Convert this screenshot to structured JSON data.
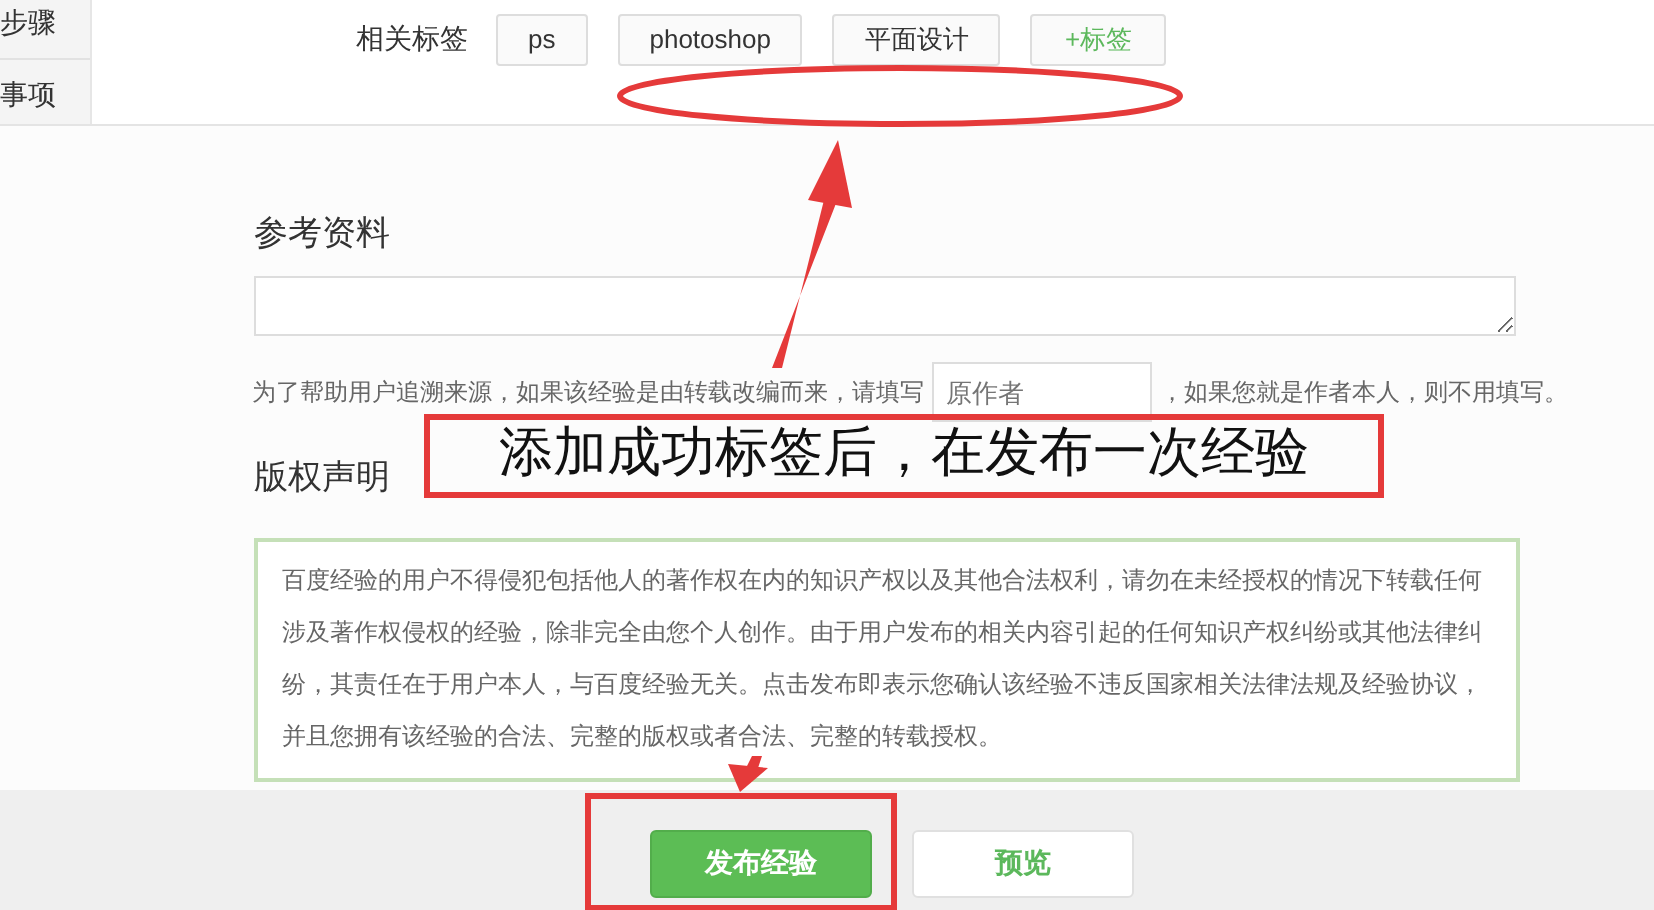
{
  "sidebar": {
    "items": [
      {
        "label": "步骤"
      },
      {
        "label": "事项"
      }
    ]
  },
  "tags": {
    "label": "相关标签",
    "items": [
      {
        "text": "ps",
        "kind": "tag"
      },
      {
        "text": "photoshop",
        "kind": "tag"
      },
      {
        "text": "平面设计",
        "kind": "tag"
      },
      {
        "text": "+标签",
        "kind": "add"
      }
    ]
  },
  "reference": {
    "heading": "参考资料",
    "hint_before": "为了帮助用户追溯来源，如果该经验是由转载改编而来，请填写",
    "author_field": {
      "placeholder": "原作者"
    },
    "hint_after": "，如果您就是作者本人，则不用填写。"
  },
  "copyright": {
    "heading": "版权声明",
    "text": "百度经验的用户不得侵犯包括他人的著作权在内的知识产权以及其他合法权利，请勿在未经授权的情况下转载任何涉及著作权侵权的经验，除非完全由您个人创作。由于用户发布的相关内容引起的任何知识产权纠纷或其他法律纠纷，其责任在于用户本人，与百度经验无关。点击发布即表示您确认该经验不违反国家相关法律法规及经验协议，并且您拥有该经验的合法、完整的版权或者合法、完整的转载授权。"
  },
  "buttons": [
    {
      "label": "发布经验",
      "kind": "primary"
    },
    {
      "label": "预览",
      "kind": "secondary"
    }
  ],
  "annotation": {
    "caption": "添加成功标签后，在发布一次经验"
  }
}
